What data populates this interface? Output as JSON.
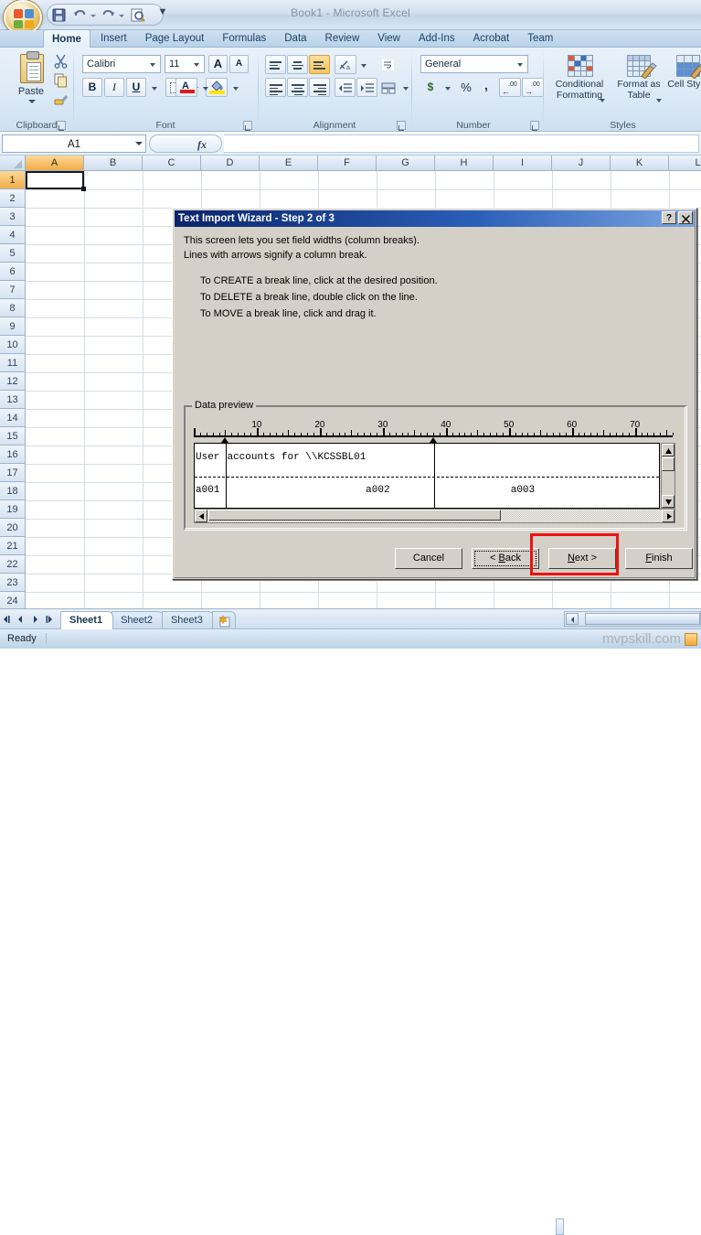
{
  "window": {
    "title": "Book1 - Microsoft Excel",
    "office_button": "office-button",
    "quick_access": [
      {
        "name": "save",
        "icon": "save-icon"
      },
      {
        "name": "undo",
        "icon": "undo-icon"
      },
      {
        "name": "redo",
        "icon": "redo-icon"
      },
      {
        "name": "print-preview",
        "icon": "print-preview-icon"
      }
    ],
    "qat_overflow": "▼"
  },
  "ribbon": {
    "tabs": [
      {
        "label": "Home",
        "active": true
      },
      {
        "label": "Insert",
        "active": false
      },
      {
        "label": "Page Layout",
        "active": false
      },
      {
        "label": "Formulas",
        "active": false
      },
      {
        "label": "Data",
        "active": false
      },
      {
        "label": "Review",
        "active": false
      },
      {
        "label": "View",
        "active": false
      },
      {
        "label": "Add-Ins",
        "active": false
      },
      {
        "label": "Acrobat",
        "active": false
      },
      {
        "label": "Team",
        "active": false
      }
    ],
    "groups": {
      "clipboard": {
        "label": "Clipboard",
        "paste": "Paste",
        "buttons": [
          "Cut",
          "Copy",
          "Format Painter"
        ]
      },
      "font": {
        "label": "Font",
        "font_name": "Calibri",
        "font_size": "11",
        "grow_font": "A",
        "shrink_font": "A",
        "bold": "B",
        "italic": "I",
        "underline": "U",
        "borders": "borders-icon",
        "fill_color": "fill-color-icon",
        "font_color": "font-color-icon"
      },
      "alignment": {
        "label": "Alignment",
        "top_align": "top-align-icon",
        "middle_align": "middle-align-icon",
        "bottom_align": "bottom-align-icon",
        "orientation": "orientation-icon",
        "align_left": "align-left-icon",
        "align_center": "align-center-icon",
        "align_right": "align-right-icon",
        "decrease_indent": "decrease-indent-icon",
        "increase_indent": "increase-indent-icon",
        "wrap_text": "wrap-text-icon",
        "merge_center": "merge-center-icon"
      },
      "number": {
        "label": "Number",
        "format": "General",
        "accounting": "$",
        "percent": "%",
        "comma": ",",
        "increase_decimal": ".00",
        "decrease_decimal": ".00"
      },
      "styles": {
        "label": "Styles",
        "conditional_formatting": "Conditional Formatting",
        "format_as_table": "Format as Table",
        "cell_styles": "Cell Styles"
      }
    }
  },
  "formula_bar": {
    "name_box": "A1",
    "cancel": "✕",
    "enter": "✓",
    "fx": "fx",
    "formula_value": ""
  },
  "grid": {
    "columns": [
      "A",
      "B",
      "C",
      "D",
      "E",
      "F",
      "G",
      "H",
      "I",
      "J",
      "K",
      "L"
    ],
    "selected_column": "A",
    "rows": [
      "1",
      "2",
      "3",
      "4",
      "5",
      "6",
      "7",
      "8",
      "9",
      "10",
      "11",
      "12",
      "13",
      "14",
      "15",
      "16",
      "17",
      "18",
      "19",
      "20",
      "21",
      "22",
      "23",
      "24"
    ],
    "selected_row": "1",
    "active_cell": "A1"
  },
  "sheet_tabs": {
    "tabs": [
      {
        "label": "Sheet1",
        "active": true
      },
      {
        "label": "Sheet2",
        "active": false
      },
      {
        "label": "Sheet3",
        "active": false
      }
    ],
    "insert_sheet": "insert-worksheet-icon",
    "nav": [
      "first-sheet",
      "prev-sheet",
      "next-sheet",
      "last-sheet"
    ]
  },
  "status_bar": {
    "status": "Ready",
    "watermark": "mvpskill.com"
  },
  "dialog": {
    "title": "Text Import Wizard - Step 2 of 3",
    "help_button": "?",
    "close_button": "✕",
    "intro": [
      "This screen lets you set field widths (column breaks).",
      "Lines with arrows signify a column break."
    ],
    "instructions": [
      "To CREATE a break line, click at the desired position.",
      "To DELETE a break line, double click on the line.",
      "To MOVE a break line, click and drag it."
    ],
    "preview_legend": "Data preview",
    "ruler": {
      "labels": [
        10,
        20,
        30,
        40,
        50,
        60,
        70
      ],
      "max": 76,
      "minor_step": 1,
      "mid_step": 5,
      "major_step": 10
    },
    "break_positions": [
      5,
      38
    ],
    "preview_rows": [
      [
        {
          "col": 0,
          "text": "User"
        },
        {
          "col": 5,
          "text": "accounts for \\\\KCSSBL01"
        }
      ],
      [
        {
          "col": 0,
          "text": "a001"
        },
        {
          "col": 27,
          "text": "a002"
        },
        {
          "col": 50,
          "text": "a003"
        }
      ]
    ],
    "buttons": [
      {
        "name": "cancel",
        "label": "Cancel",
        "accel": "",
        "focus": false,
        "highlight": false
      },
      {
        "name": "back",
        "label": "< Back",
        "accel": "B",
        "focus": true,
        "highlight": false
      },
      {
        "name": "next",
        "label": "Next >",
        "accel": "N",
        "focus": false,
        "highlight": true
      },
      {
        "name": "finish",
        "label": "Finish",
        "accel": "F",
        "focus": false,
        "highlight": false
      }
    ],
    "highlight_color": "#ee1111"
  }
}
